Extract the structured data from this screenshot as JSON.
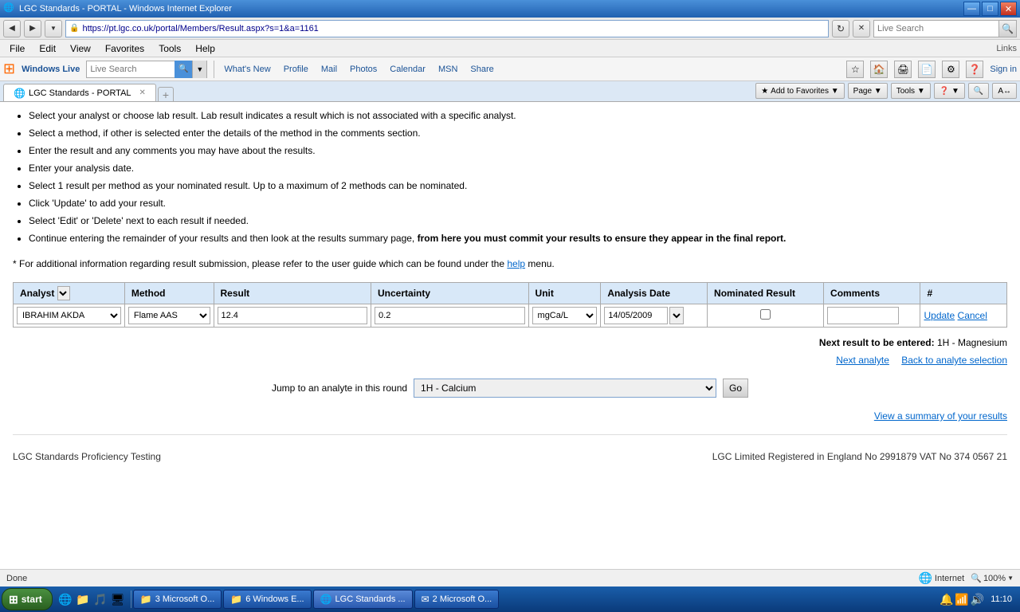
{
  "titleBar": {
    "title": "LGC Standards - PORTAL - Windows Internet Explorer",
    "icon": "🌐",
    "buttons": [
      "—",
      "□",
      "✕"
    ]
  },
  "addressBar": {
    "url": "https://pt.lgc.co.uk/portal/Members/Result.aspx?s=1&a=1161",
    "searchPlaceholder": "Live Search"
  },
  "menuBar": {
    "items": [
      "File",
      "Edit",
      "View",
      "Favorites",
      "Tools",
      "Help"
    ],
    "linksLabel": "Links"
  },
  "toolbar": {
    "windowsLive": "Windows Live",
    "liveSearch": "Live Search",
    "navItems": [
      "What's New",
      "Profile",
      "Mail",
      "Photos",
      "Calendar",
      "MSN",
      "Share"
    ],
    "signIn": "Sign in"
  },
  "tabs": [
    {
      "label": "LGC Standards - PORTAL",
      "icon": "🌐",
      "active": true
    }
  ],
  "instructions": [
    "Select your analyst or choose lab result. Lab result indicates a result which is not associated with a specific analyst.",
    "Select a method, if other is selected enter the details of the method in the comments section.",
    "Enter the result and any comments you may have about the results.",
    "Enter your analysis date.",
    "Select 1 result per method as your nominated result. Up to a maximum of 2 methods can be nominated.",
    "Click 'Update' to add your result.",
    "Select 'Edit' or 'Delete' next to each result if needed.",
    "Continue entering the remainder of your results and then look at the results summary page, from here you must commit your results to ensure they appear in the final report."
  ],
  "infoNote": "* For additional information regarding result submission, please refer to the user guide which can be found under the help menu.",
  "table": {
    "headers": [
      "Analyst",
      "Method",
      "Result",
      "Uncertainty",
      "Unit",
      "Analysis Date",
      "Nominated Result",
      "Comments",
      "#"
    ],
    "row": {
      "analyst": "IBRAHIM AKDA",
      "method": "Flame AAS",
      "result": "12.4",
      "uncertainty": "0.2",
      "unit": "mgCa/L",
      "analysisDate": "14/05/2009",
      "nominatedResult": false,
      "comments": "",
      "updateLabel": "Update",
      "cancelLabel": "Cancel"
    }
  },
  "nextResult": {
    "label": "Next result to be entered:",
    "value": "1H - Magnesium"
  },
  "navLinks": {
    "nextAnalyte": "Next analyte",
    "backToSelection": "Back to analyte selection"
  },
  "jumpRound": {
    "label": "Jump to an analyte in this round",
    "selected": "1H - Calcium",
    "goLabel": "Go"
  },
  "summaryLink": "View a summary of your results",
  "footer": {
    "left": "LGC Standards Proficiency Testing",
    "right": "LGC Limited Registered in England No 2991879 VAT No 374 0567 21"
  },
  "statusBar": {
    "status": "Done",
    "internet": "Internet",
    "zoom": "100%"
  },
  "taskbar": {
    "start": "start",
    "time": "11:10",
    "buttons": [
      {
        "icon": "🌐",
        "label": "LGC Standards ..."
      },
      {
        "icon": "📁",
        "label": "6 Windows E..."
      },
      {
        "icon": "📁",
        "label": "3 Microsoft O..."
      },
      {
        "icon": "✉",
        "label": "2 Microsoft O..."
      }
    ]
  }
}
